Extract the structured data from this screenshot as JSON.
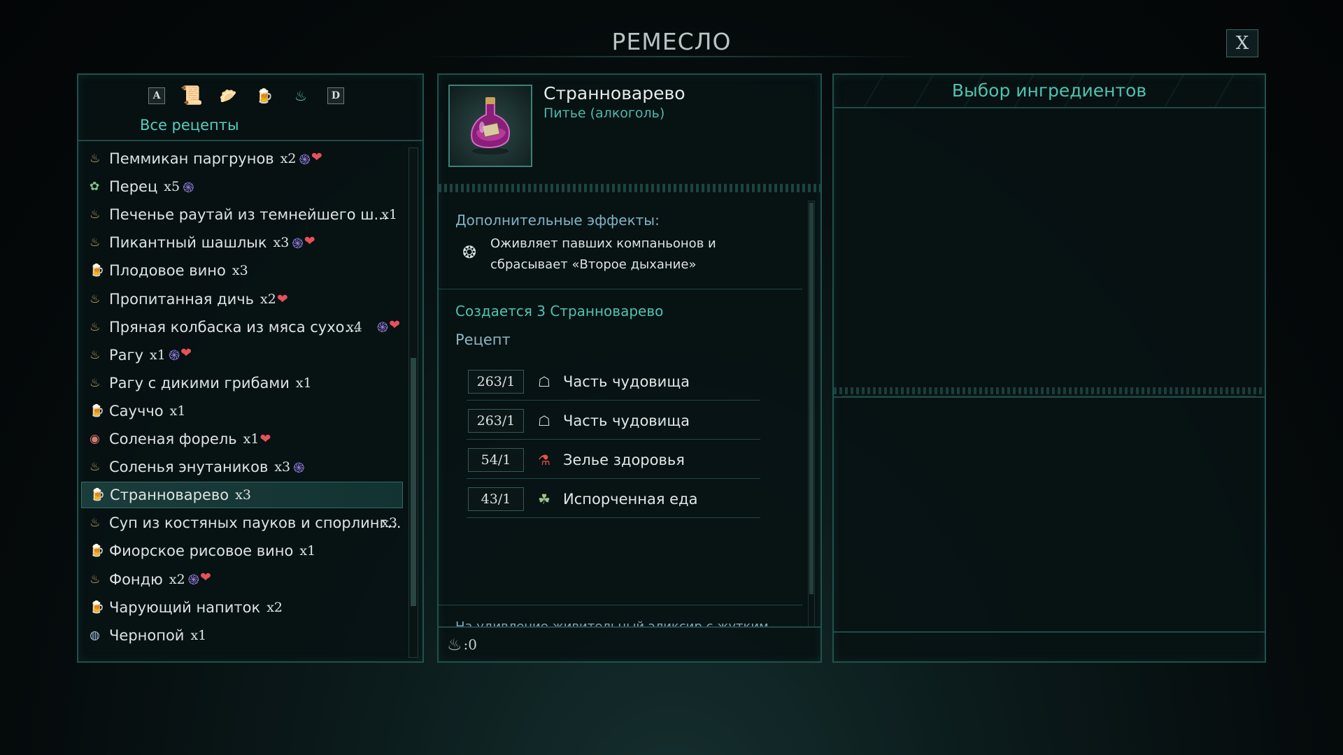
{
  "window": {
    "title": "РЕМЕСЛО",
    "close_label": "X"
  },
  "filters": {
    "items": [
      {
        "name": "sort-a-key",
        "glyph": "A"
      },
      {
        "name": "recipe-scroll-icon",
        "glyph": "📜"
      },
      {
        "name": "food-icon",
        "glyph": "🥟"
      },
      {
        "name": "drink-icon",
        "glyph": "🍺"
      },
      {
        "name": "dish-icon",
        "glyph": "♨"
      },
      {
        "name": "sort-d-key",
        "glyph": "D"
      }
    ],
    "label": "Все рецепты"
  },
  "recipes": [
    {
      "icon": "♨",
      "kind": "dish",
      "name": "Пеммикан паргрунов",
      "qty": "x2",
      "buff": true,
      "heart": true
    },
    {
      "icon": "✿",
      "kind": "veg",
      "name": "Перец",
      "qty": "x5",
      "buff": true,
      "heart": false
    },
    {
      "icon": "♨",
      "kind": "dish",
      "name": "Печенье раутай из темнейшего ш...",
      "qty": "x1",
      "buff": false,
      "heart": false,
      "qty_right": true
    },
    {
      "icon": "♨",
      "kind": "dish",
      "name": "Пикантный шашлык",
      "qty": "x3",
      "buff": true,
      "heart": true
    },
    {
      "icon": "🍺",
      "kind": "drink",
      "name": "Плодовое вино",
      "qty": "x3",
      "buff": false,
      "heart": false
    },
    {
      "icon": "♨",
      "kind": "dish",
      "name": "Пропитанная дичь",
      "qty": "x2",
      "buff": false,
      "heart": true
    },
    {
      "icon": "♨",
      "kind": "dish",
      "name": "Пряная колбаска из мяса сухо...",
      "qty": "x4",
      "buff": true,
      "heart": true,
      "qty_right": true
    },
    {
      "icon": "♨",
      "kind": "dish",
      "name": "Рагу",
      "qty": "x1",
      "buff": true,
      "heart": true
    },
    {
      "icon": "♨",
      "kind": "dish",
      "name": "Рагу с дикими грибами",
      "qty": "x1",
      "buff": false,
      "heart": false
    },
    {
      "icon": "🍺",
      "kind": "drink",
      "name": "Сауччо",
      "qty": "x1",
      "buff": false,
      "heart": false
    },
    {
      "icon": "◉",
      "kind": "fish",
      "name": "Соленая форель",
      "qty": "x1",
      "buff": false,
      "heart": true
    },
    {
      "icon": "♨",
      "kind": "dish",
      "name": "Соленья энутаников",
      "qty": "x3",
      "buff": true,
      "heart": false
    },
    {
      "icon": "🍺",
      "kind": "drink",
      "name": "Странноварево",
      "qty": "x3",
      "buff": false,
      "heart": false,
      "selected": true
    },
    {
      "icon": "♨",
      "kind": "dish",
      "name": "Суп из костяных пауков и спорлинг...",
      "qty": "x3",
      "buff": false,
      "heart": false,
      "qty_right": true
    },
    {
      "icon": "🍺",
      "kind": "drink",
      "name": "Фиорское рисовое вино",
      "qty": "x1",
      "buff": false,
      "heart": false
    },
    {
      "icon": "♨",
      "kind": "dish",
      "name": "Фондю",
      "qty": "x2",
      "buff": true,
      "heart": true
    },
    {
      "icon": "🍺",
      "kind": "drink",
      "name": "Чарующий напиток",
      "qty": "x2",
      "buff": false,
      "heart": false
    },
    {
      "icon": "◍",
      "kind": "bowl",
      "name": "Чернопой",
      "qty": "x1",
      "buff": false,
      "heart": false
    }
  ],
  "detail": {
    "name": "Странноварево",
    "type": "Питье (алкоголь)",
    "effects_title": "Дополнительные эффекты:",
    "effect_text": "Оживляет павших компаньонов и сбрасывает «Второе дыхание»",
    "creates": "Создается 3 Странноварево",
    "recipe_label": "Рецепт",
    "ingredients": [
      {
        "qty": "263/1",
        "icon": "☖",
        "icon_color": "#d8dede",
        "name": "Часть чудовища"
      },
      {
        "qty": "263/1",
        "icon": "☖",
        "icon_color": "#d8dede",
        "name": "Часть чудовища"
      },
      {
        "qty": "54/1",
        "icon": "⚗",
        "icon_color": "#e0504a",
        "name": "Зелье здоровья"
      },
      {
        "qty": "43/1",
        "icon": "☘",
        "icon_color": "#9fc48a",
        "name": "Испорченная еда"
      }
    ],
    "description": "На удивление живительный эликсир с жутким рецептом. Провальное изобретение анимантов-самоучек из Дирвуда, которые надеялись с его помощью вселять души в пусторожденных",
    "footer_value": ":0"
  },
  "ingredient_panel": {
    "title": "Выбор ингредиентов"
  },
  "colors": {
    "accent": "#4fc3b1",
    "border": "#21504d",
    "buff": "#9a83e8",
    "heart": "#e8505a"
  }
}
